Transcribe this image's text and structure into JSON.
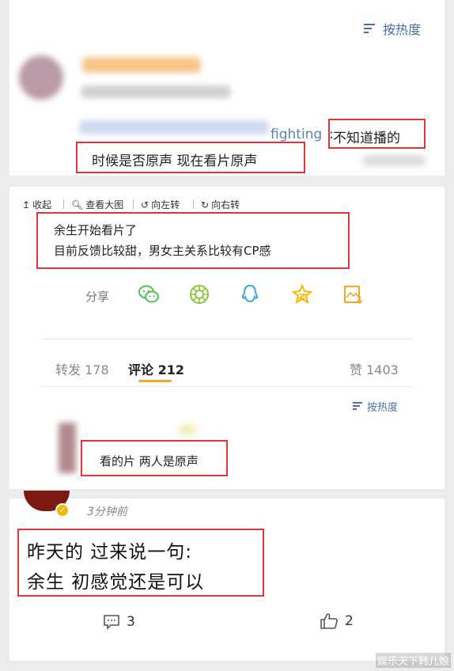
{
  "panel1": {
    "sort_label": "按热度",
    "reply_mention": "fighting",
    "reply_colon": ":",
    "reply_line1_tail": "不知道播的",
    "reply_line2": "时候是否原声 现在看片原声"
  },
  "toolbar": {
    "collapse": "收起",
    "view_large": "查看大图",
    "rotate_left": "向左转",
    "rotate_right": "向右转"
  },
  "post": {
    "line1": "余生开始看片了",
    "line2": "目前反馈比较甜，男女主关系比较有CP感"
  },
  "share": {
    "label": "分享",
    "icons": [
      "wechat-icon",
      "moments-icon",
      "qq-icon",
      "qzone-icon",
      "save-image-icon"
    ]
  },
  "tabs": {
    "repost": "转发 178",
    "comment": "评论 212",
    "like": "赞 1403"
  },
  "comments_sort_label": "按热度",
  "comment": {
    "text": "看的片 两人是原声"
  },
  "panel3": {
    "time": "3分钟前",
    "line1": "昨天的 过来说一句:",
    "line2": "余生 初感觉还是可以",
    "comment_count": "3",
    "like_count": "2"
  },
  "watermark": "娱乐天下韩儿娘",
  "colors": {
    "highlight_border": "#e0343b",
    "link_blue": "#4a6fa8",
    "tab_active_underline": "#f5a623",
    "wechat_green": "#4fc34f",
    "qq_blue": "#3ba7e6",
    "qzone_yellow": "#f5b800"
  }
}
